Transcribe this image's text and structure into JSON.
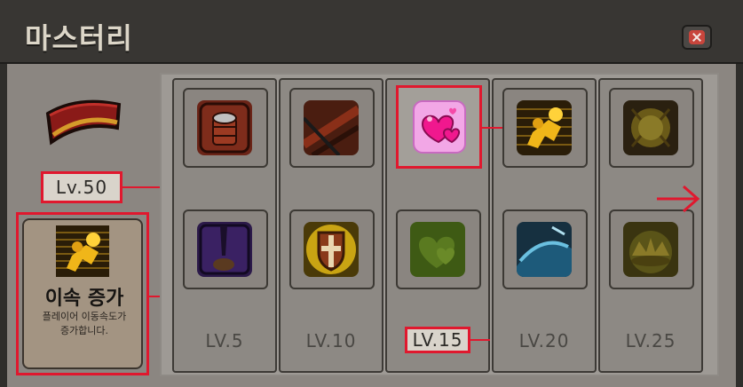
{
  "window": {
    "title": "마스터리"
  },
  "header": {
    "close_icon": "close-icon"
  },
  "character": {
    "level_label": "Lv.50",
    "hat_icon": "red-hat-icon"
  },
  "selected_skill": {
    "name": "이속 증가",
    "description_line1": "플레이어 이동속도가",
    "description_line2": "증가합니다.",
    "icon": "running-man-icon"
  },
  "columns": [
    {
      "level_label": "LV.5",
      "top_icon": "coin-stack-icon",
      "bottom_icon": "dark-sword-icon"
    },
    {
      "level_label": "LV.10",
      "top_icon": "slash-icon",
      "bottom_icon": "shield-cross-icon"
    },
    {
      "level_label": "LV.15",
      "top_icon": "hearts-icon",
      "bottom_icon": "heart-green-icon"
    },
    {
      "level_label": "LV.20",
      "top_icon": "running-man-icon",
      "bottom_icon": "wave-icon"
    },
    {
      "level_label": "LV.25",
      "top_icon": "orb-icon",
      "bottom_icon": "crown-icon"
    }
  ],
  "colors": {
    "highlight": "#e0182e",
    "panel": "#8b8681",
    "title_text": "#dcd6c8"
  },
  "navigation": {
    "next_icon": "arrow-right-icon"
  }
}
